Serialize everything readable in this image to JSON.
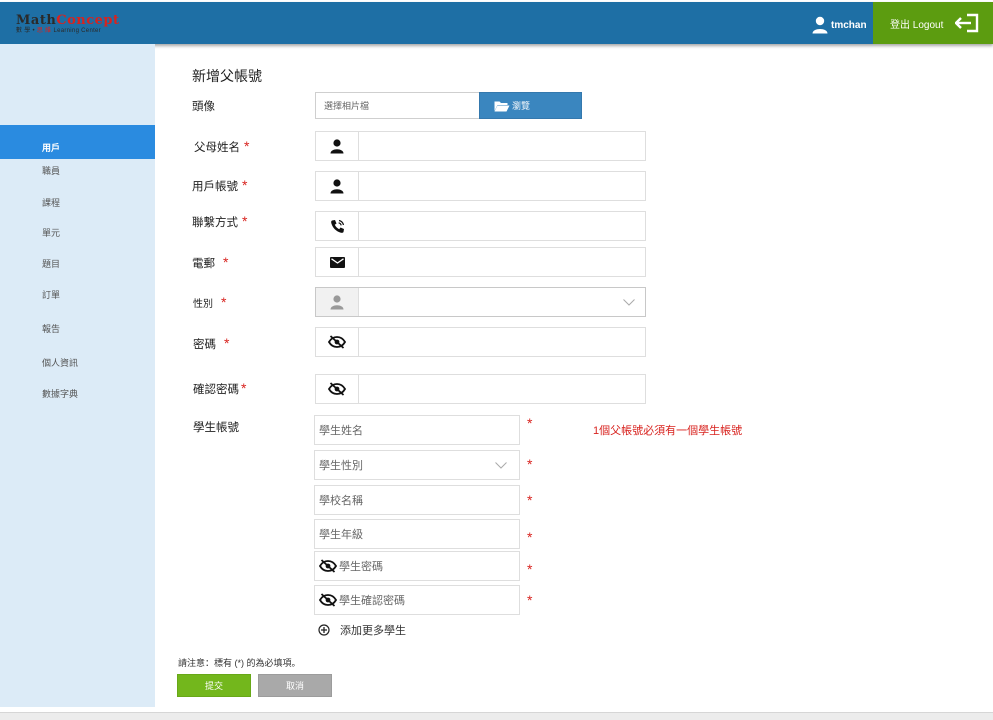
{
  "header": {
    "logo_main_a": "Math",
    "logo_main_b": "Concept",
    "logo_sub_a": "數 學 • ",
    "logo_sub_b": "思 維",
    "logo_sub_c": " Learning Center",
    "username": "tmchan",
    "logout_label": "登出 Logout",
    "colors": {
      "bar": "#1e6fa5",
      "logout": "#5c9c10"
    }
  },
  "sidebar": {
    "items": [
      {
        "label": "用戶",
        "active": true
      },
      {
        "label": "職員"
      },
      {
        "label": "課程"
      },
      {
        "label": "單元"
      },
      {
        "label": "題目"
      },
      {
        "label": "訂單"
      },
      {
        "label": "報告"
      },
      {
        "label": "個人資訊"
      },
      {
        "label": "數據字典"
      }
    ]
  },
  "form": {
    "title": "新增父帳號",
    "avatar_label": "頭像",
    "file_placeholder": "選擇相片檔",
    "browse_label": "瀏覽",
    "parent_name_label": "父母姓名",
    "account_label": "用戶帳號",
    "contact_label": "聯繫方式",
    "email_label": "電郵",
    "gender_label": "性別",
    "password_label": "密碼",
    "confirm_password_label": "確認密碼",
    "required_mark": "*",
    "icons": [
      "user-icon",
      "user-icon",
      "phone-icon",
      "mail-icon",
      "user-icon",
      "eye-slash-icon",
      "eye-slash-icon"
    ]
  },
  "students": {
    "label": "學生帳號",
    "name_placeholder": "學生姓名",
    "gender_placeholder": "學生性別",
    "school_placeholder": "學校名稱",
    "grade_placeholder": "學生年級",
    "password_placeholder": "學生密碼",
    "confirm_password_placeholder": "學生確認密碼",
    "warning": "1個父帳號必須有一個學生帳號",
    "add_more_label": "添加更多學生"
  },
  "footer": {
    "note": "請注意：標有 (*) 的為必填項。",
    "submit_label": "提交",
    "cancel_label": "取消"
  }
}
